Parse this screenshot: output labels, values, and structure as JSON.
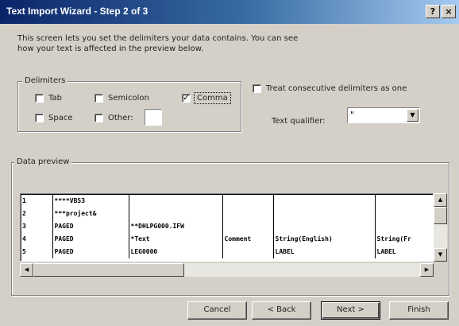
{
  "window": {
    "title": "Text Import Wizard - Step 2 of 3",
    "help_glyph": "?",
    "close_glyph": "×"
  },
  "description": "This screen lets you set the delimiters your data contains.  You can see\nhow your text is affected in the preview below.",
  "delimiters": {
    "label": "Delimiters",
    "tab": {
      "label": "Tab",
      "checked": false
    },
    "semicolon": {
      "label": "Semicolon",
      "checked": false
    },
    "comma": {
      "label": "Comma",
      "checked": true
    },
    "space": {
      "label": "Space",
      "checked": false
    },
    "other": {
      "label": "Other:",
      "checked": false,
      "value": ""
    }
  },
  "treat_consecutive": {
    "label": "Treat consecutive delimiters as one",
    "checked": false
  },
  "text_qualifier": {
    "label": "Text qualifier:",
    "value": "\""
  },
  "preview": {
    "label": "Data preview",
    "rows": [
      [
        "1",
        "****VBS3",
        "",
        "",
        "",
        ""
      ],
      [
        "2",
        "***project&",
        "",
        "",
        "",
        ""
      ],
      [
        "3",
        "PAGED",
        "**DHLPG000.IFW",
        "",
        "",
        ""
      ],
      [
        "4",
        "PAGED",
        "*Text",
        "Comment",
        "String(English)",
        "String(Fr"
      ],
      [
        "5",
        "PAGED",
        "LEG0000",
        "",
        "LABEL",
        "LABEL"
      ]
    ]
  },
  "buttons": {
    "cancel": "Cancel",
    "back": "< Back",
    "next": "Next >",
    "finish": "Finish"
  }
}
